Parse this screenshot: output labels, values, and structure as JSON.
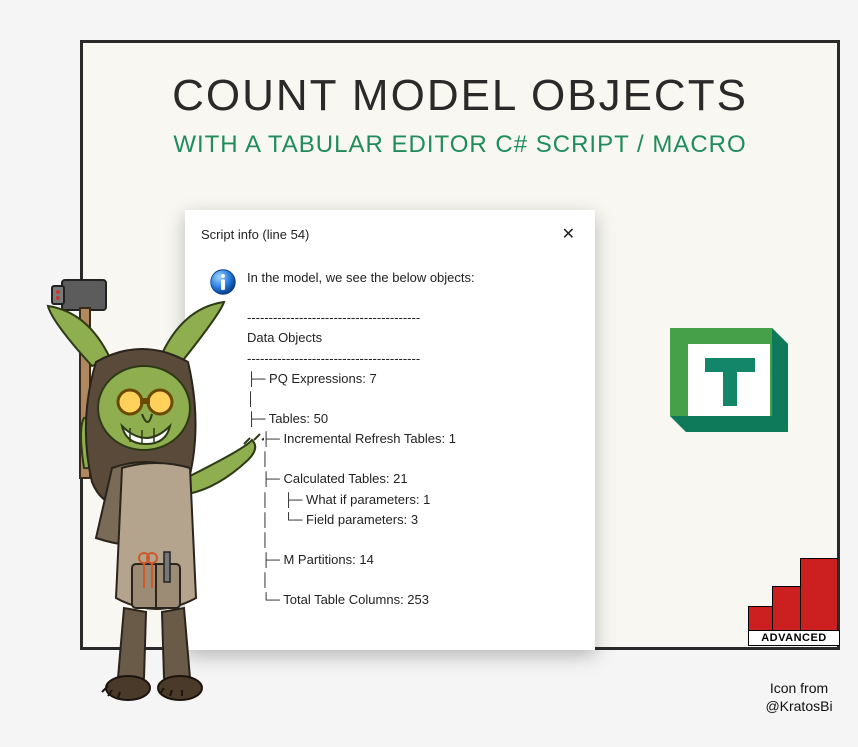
{
  "heading": {
    "title": "COUNT MODEL OBJECTS",
    "subtitle": "WITH A TABULAR EDITOR C# SCRIPT / MACRO"
  },
  "dialog": {
    "title": "Script info (line 54)",
    "close": "✕",
    "intro": "In the model, we see the below objects:",
    "section_heading": "Data Objects",
    "divider": "----------------------------------------",
    "lines": {
      "pq": "├─ PQ Expressions: 7",
      "pq_pipe": "│",
      "tables": "├─ Tables: 50",
      "inc": "    ├─ Incremental Refresh Tables: 1",
      "inc_pipe": "    │",
      "calc": "    ├─ Calculated Tables: 21",
      "whatif": "    │    ├─ What if parameters: 1",
      "fieldp": "    │    └─ Field parameters: 3",
      "calc_pipe": "    │",
      "mpart": "    ├─ M Partitions: 14",
      "mpart_pipe": "    │",
      "totalcols": "    └─ Total Table Columns: 253"
    }
  },
  "badge": {
    "label": "ADVANCED"
  },
  "attribution": {
    "line1": "Icon from",
    "line2": "@KratosBi"
  }
}
